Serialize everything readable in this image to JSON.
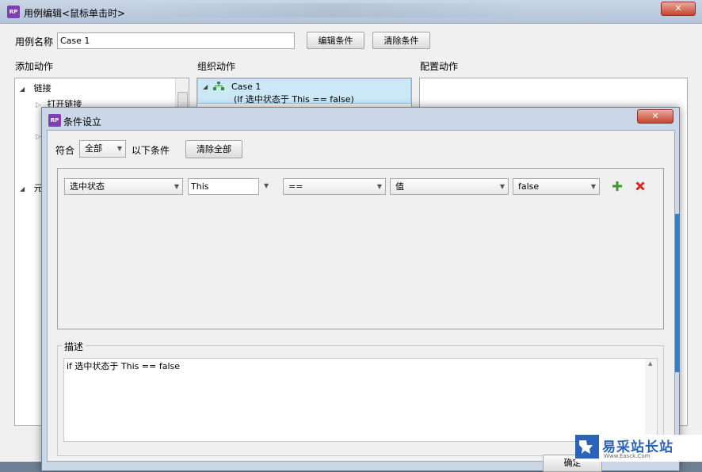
{
  "outer": {
    "title": "用例编辑<鼠标单击时>",
    "app_icon": "RP",
    "close_label": "✕",
    "case_name_label": "用例名称",
    "case_name_value": "Case 1",
    "edit_condition_button": "编辑条件",
    "clear_condition_button": "清除条件",
    "add_action_header": "添加动作",
    "organize_action_header": "组织动作",
    "config_action_header": "配置动作",
    "add_action_tree": {
      "group_links": "链接",
      "item_open_link": "打开链接",
      "group_elements_partial": "元"
    },
    "organize_tree": {
      "case_label": "Case 1",
      "case_condition": "(If 选中状态于 This == false)"
    }
  },
  "dialog": {
    "title": "条件设立",
    "app_icon": "RP",
    "close_label": "✕",
    "match_label": "符合",
    "match_value": "全部",
    "suffix_label": "以下条件",
    "clear_all_button": "清除全部",
    "condition_row": {
      "property": "选中状态",
      "target": "This",
      "operator": "==",
      "value_type": "值",
      "value": "false",
      "add_icon": "plus-icon",
      "delete_icon": "delete-x-icon"
    },
    "description_label": "描述",
    "description_text": "if 选中状态于 This == false",
    "ok_button_partial": "确定"
  },
  "watermark": {
    "title": "易采站长站",
    "subtitle": "Www.Easck.Com"
  },
  "colors": {
    "accent_purple": "#7d3fb3",
    "selected_row": "#cce8f7",
    "add_green": "#3c9a2a",
    "delete_red": "#d9251c",
    "close_red": "#c7452f"
  }
}
